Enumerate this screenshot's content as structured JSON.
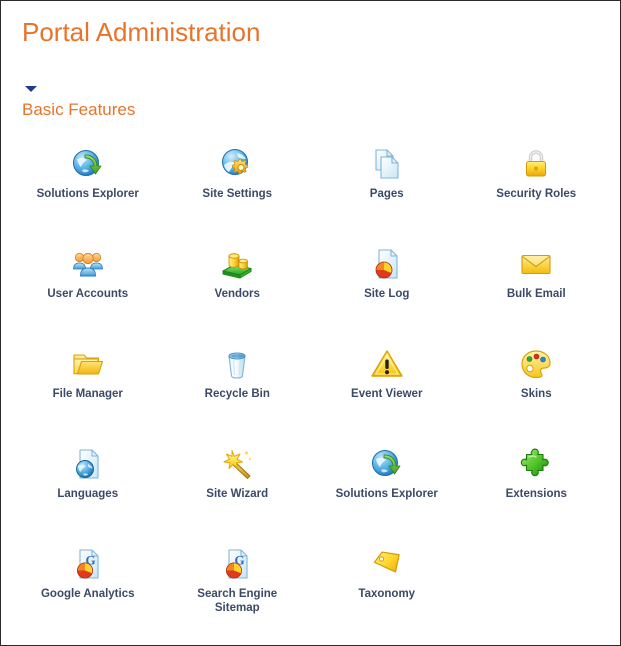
{
  "page": {
    "title": "Portal Administration",
    "title_color": "#E8742C",
    "background": "#FFFFFF",
    "border_color": "#2B2B2B"
  },
  "section": {
    "label": "Basic Features",
    "label_color": "#E8742C",
    "toggle_icon": "chevron-down-icon",
    "toggle_state": "expanded",
    "toggle_color": "#1F3C8C"
  },
  "grid": {
    "columns": 4,
    "label_color": "#3B4A66",
    "items": [
      {
        "label": "Solutions Explorer",
        "icon": "globe-green-arrow-icon"
      },
      {
        "label": "Site Settings",
        "icon": "globe-gear-icon"
      },
      {
        "label": "Pages",
        "icon": "documents-stack-icon"
      },
      {
        "label": "Security Roles",
        "icon": "padlock-icon"
      },
      {
        "label": "User Accounts",
        "icon": "users-group-icon"
      },
      {
        "label": "Vendors",
        "icon": "money-coins-icon"
      },
      {
        "label": "Site Log",
        "icon": "document-piechart-icon"
      },
      {
        "label": "Bulk Email",
        "icon": "envelope-icon"
      },
      {
        "label": "File Manager",
        "icon": "folder-open-icon"
      },
      {
        "label": "Recycle Bin",
        "icon": "recycle-bin-icon"
      },
      {
        "label": "Event Viewer",
        "icon": "warning-triangle-icon"
      },
      {
        "label": "Skins",
        "icon": "paint-palette-icon"
      },
      {
        "label": "Languages",
        "icon": "document-globe-icon"
      },
      {
        "label": "Site Wizard",
        "icon": "magic-wand-icon"
      },
      {
        "label": "Solutions Explorer",
        "icon": "globe-green-arrow-icon"
      },
      {
        "label": "Extensions",
        "icon": "puzzle-piece-icon"
      },
      {
        "label": "Google Analytics",
        "icon": "document-piechart-g-icon"
      },
      {
        "label": "Search Engine Sitemap",
        "icon": "document-piechart-g-icon"
      },
      {
        "label": "Taxonomy",
        "icon": "price-tag-icon"
      },
      {
        "label": "",
        "icon": ""
      }
    ]
  }
}
